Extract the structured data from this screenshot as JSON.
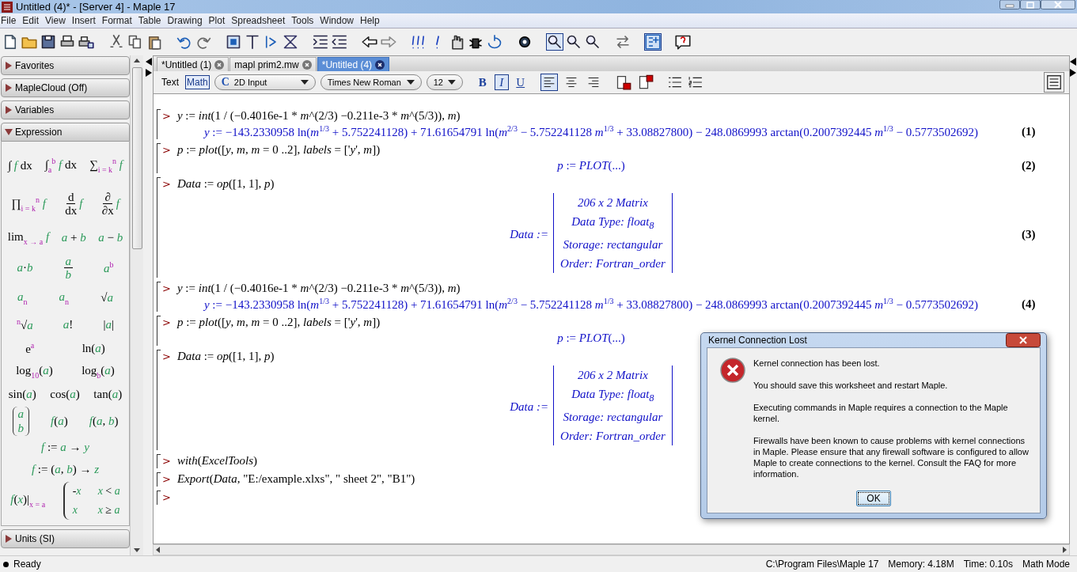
{
  "window": {
    "title": "Untitled (4)* - [Server 4] - Maple 17"
  },
  "menu": [
    "File",
    "Edit",
    "View",
    "Insert",
    "Format",
    "Table",
    "Drawing",
    "Plot",
    "Spreadsheet",
    "Tools",
    "Window",
    "Help"
  ],
  "palettes": [
    {
      "label": "Favorites",
      "expanded": false
    },
    {
      "label": "MapleCloud (Off)",
      "expanded": false
    },
    {
      "label": "Variables",
      "expanded": false
    },
    {
      "label": "Expression",
      "expanded": true,
      "rows": [
        [
          {
            "kind": "math",
            "text": "∫ *f* dx"
          },
          {
            "kind": "math",
            "text": "∫$_{a}$$^{b}$ *f* dx"
          },
          {
            "kind": "math",
            "text": "∑$_{i = k}$$^{n}$ *f*"
          }
        ],
        [
          {
            "kind": "math",
            "text": "∏$_{i = k}$$^{n}$ *f*"
          },
          {
            "kind": "fraction",
            "top": "d",
            "bottom": "dx",
            "after": "*f*"
          },
          {
            "kind": "fraction",
            "top": "∂",
            "bottom": "∂x",
            "after": "*f*"
          }
        ],
        [
          {
            "kind": "math",
            "text": "lim$_{x → a}$ *f*"
          },
          {
            "kind": "math",
            "text": "*a* + *b*"
          },
          {
            "kind": "math",
            "text": "*a* − *b*"
          }
        ],
        [
          {
            "kind": "math",
            "text": "*a*·*b*"
          },
          {
            "kind": "fraction",
            "top": "*a*",
            "bottom": "*b*"
          },
          {
            "kind": "math",
            "text": "*a*$^{b}$"
          }
        ],
        [
          {
            "kind": "math",
            "text": "*a*$_{n}$"
          },
          {
            "kind": "math",
            "text": "*a*$_{n}$"
          },
          {
            "kind": "math",
            "text": "√*a*"
          }
        ],
        [
          {
            "kind": "math",
            "text": "$^{n}$√*a*"
          },
          {
            "kind": "math",
            "text": "*a*!"
          },
          {
            "kind": "math",
            "text": "|*a*|"
          }
        ],
        [
          {
            "kind": "math",
            "text": "e$^{a}$"
          },
          {
            "kind": "math",
            "text": "ln(*a*)"
          }
        ],
        [
          {
            "kind": "math",
            "text": "log$_{10}$(*a*)"
          },
          {
            "kind": "math",
            "text": "log$_{b}$(*a*)"
          }
        ],
        [
          {
            "kind": "math",
            "text": "sin(*a*)"
          },
          {
            "kind": "math",
            "text": "cos(*a*)"
          },
          {
            "kind": "math",
            "text": "tan(*a*)"
          }
        ],
        [
          {
            "kind": "column",
            "entries": [
              "*a*",
              "*b*"
            ]
          },
          {
            "kind": "math",
            "text": "*f*(*a*)"
          },
          {
            "kind": "math",
            "text": "*f*(*a*, *b*)"
          }
        ],
        [
          {
            "kind": "math",
            "text": "*f* := *a* → *y*"
          }
        ],
        [
          {
            "kind": "math",
            "text": "*f* := (*a*, *b*) → *z*"
          }
        ],
        [
          {
            "kind": "math",
            "text": "*f*(*x*)|$_{x = a}$"
          },
          {
            "kind": "cases",
            "entries": [
              [
                "-*x*",
                "*x* < *a*"
              ],
              [
                "*x*",
                "*x* ≥ *a*"
              ]
            ]
          }
        ]
      ]
    },
    {
      "label": "Units (SI)",
      "expanded": false
    }
  ],
  "tabs": [
    {
      "label": "*Untitled (1)",
      "selected": false
    },
    {
      "label": "mapl prim2.mw",
      "selected": false
    },
    {
      "label": "*Untitled (4)",
      "selected": true
    }
  ],
  "format_bar": {
    "modes": [
      {
        "label": "Text",
        "selected": false
      },
      {
        "label": "Math",
        "selected": true
      }
    ],
    "mode_glyph": "C",
    "input_mode": "2D Input",
    "font": "Times New Roman",
    "size": "12",
    "styles": [
      {
        "label": "B",
        "kind": "bold",
        "on": false
      },
      {
        "label": "I",
        "kind": "italic",
        "on": true
      },
      {
        "label": "U",
        "kind": "underline",
        "on": false
      }
    ],
    "alignment": [
      {
        "kind": "left",
        "selected": true
      },
      {
        "kind": "center",
        "selected": false
      },
      {
        "kind": "right",
        "selected": false
      }
    ]
  },
  "worksheet": {
    "groups": [
      {
        "kind": "command",
        "prompt": ">",
        "input": "*y* := *int*(1 / (−0.4016e-1 * *m*^(2/3) −0.211e-3 * *m*^(5/3)), *m*)",
        "outputs": [
          {
            "kind": "line",
            "text": "*y* := −143.2330958 ln(*m*$^{1/3}$ + 5.752241128) + 71.61654791 ln(*m*$^{2/3}$ − 5.752241128 *m*$^{1/3}$ + 33.08827800) − 248.0869993 arctan(0.2007392445 *m*$^{1/3}$ − 0.5773502692)",
            "label": "(1)"
          }
        ]
      },
      {
        "kind": "command",
        "prompt": ">",
        "input": "*p* := *plot*([*y*, *m*, *m* = 0 ..2], *labels* = ['*y*', *m*])",
        "outputs": [
          {
            "kind": "line",
            "text": "*p* := *PLOT*(...)",
            "label": "(2)"
          }
        ]
      },
      {
        "kind": "command",
        "prompt": ">",
        "input": "*Data* := *op*([1, 1], *p*)",
        "outputs": [
          {
            "kind": "matrix",
            "lhs": "Data :=",
            "rows": [
              "206 x 2 Matrix",
              "Data Type: float$_{8}$",
              "Storage: rectangular",
              "Order: Fortran_order"
            ],
            "label": "(3)"
          }
        ]
      },
      {
        "kind": "command",
        "prompt": ">",
        "input": "*y* := *int*(1 / (−0.4016e-1 * *m*^(2/3) −0.211e-3 * *m*^(5/3)), *m*)",
        "outputs": [
          {
            "kind": "line",
            "text": "*y* := −143.2330958 ln(*m*$^{1/3}$ + 5.752241128) + 71.61654791 ln(*m*$^{2/3}$ − 5.752241128 *m*$^{1/3}$ + 33.08827800) − 248.0869993 arctan(0.2007392445 *m*$^{1/3}$ − 0.5773502692)",
            "label": "(4)"
          }
        ]
      },
      {
        "kind": "command",
        "prompt": ">",
        "input": "*p* := *plot*([*y*, *m*, *m* = 0 ..2], *labels* = ['*y*', *m*])",
        "outputs": [
          {
            "kind": "line",
            "text": "*p* := *PLOT*(...)"
          }
        ]
      },
      {
        "kind": "command",
        "prompt": ">",
        "input": "*Data* := *op*([1, 1], *p*)",
        "outputs": [
          {
            "kind": "matrix",
            "lhs": "Data :=",
            "rows": [
              "206 x 2 Matrix",
              "Data Type: float$_{8}$",
              "Storage: rectangular",
              "Order: Fortran_order"
            ]
          }
        ]
      },
      {
        "kind": "command",
        "prompt": ">",
        "input": "*with*(*ExcelTools*)"
      },
      {
        "kind": "command",
        "prompt": ">",
        "input": "*Export*(*Data*, \"E:/example.xlxs\", \" sheet 2\", \"B1\")"
      },
      {
        "kind": "prompt",
        "prompt": ">"
      }
    ]
  },
  "dialog": {
    "title": "Kernel Connection Lost",
    "paragraphs": [
      "Kernel connection has been lost.",
      "You should save this worksheet and restart Maple.",
      "Executing commands in Maple requires a connection to the Maple kernel.",
      "Firewalls have been known to cause problems with kernel connections in Maple. Please ensure that any firewall software is configured to allow Maple to create connections to the kernel. Consult the FAQ for more information."
    ],
    "button": "OK"
  },
  "status_bar": {
    "state": "Ready",
    "path": "C:\\Program Files\\Maple 17",
    "memory": "Memory: 4.18M",
    "time": "Time: 0.10s",
    "mode": "Math Mode"
  }
}
